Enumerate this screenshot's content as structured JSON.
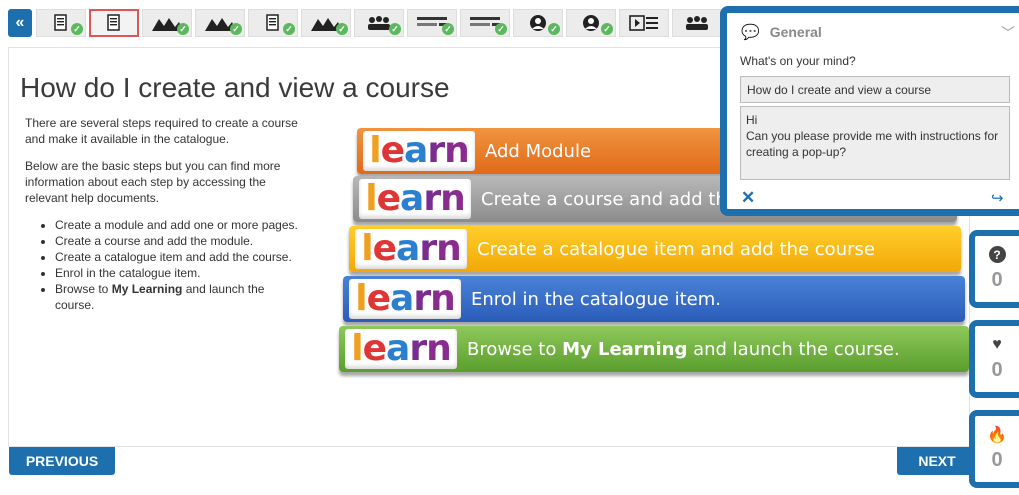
{
  "nav": {
    "back_label": "«"
  },
  "thumbnails": [
    {
      "icon": "document-icon",
      "completed": true,
      "active": false
    },
    {
      "icon": "document-icon",
      "completed": false,
      "active": true
    },
    {
      "icon": "people-icon",
      "completed": true,
      "active": false
    },
    {
      "icon": "people-icon",
      "completed": true,
      "active": false
    },
    {
      "icon": "document-icon",
      "completed": true,
      "active": false
    },
    {
      "icon": "people-icon",
      "completed": true,
      "active": false
    },
    {
      "icon": "group-icon",
      "completed": true,
      "active": false
    },
    {
      "icon": "form-icon",
      "completed": true,
      "active": false
    },
    {
      "icon": "form-icon",
      "completed": true,
      "active": false
    },
    {
      "icon": "person-circle-icon",
      "completed": true,
      "active": false
    },
    {
      "icon": "person-circle-icon",
      "completed": true,
      "active": false
    },
    {
      "icon": "video-list-icon",
      "completed": false,
      "active": false
    },
    {
      "icon": "group-icon",
      "completed": false,
      "active": false
    }
  ],
  "content": {
    "title": "How do I create and view a course",
    "intro1": "There are several steps required to create a course and make it available in the catalogue.",
    "intro2": "Below are the basic steps but you can find more information about each step by accessing the relevant help documents.",
    "steps": [
      "Create a module and add one or more pages.",
      "Create a course and add the module.",
      "Create a catalogue item and add the course.",
      "Enrol in the catalogue item.",
      "Browse to My Learning and launch the course."
    ],
    "step5_prefix": "Browse to ",
    "step5_bold": "My Learning",
    "step5_suffix": " and launch the course."
  },
  "banners": {
    "logo_text": "learn",
    "b1": "Add Module",
    "b2": "Create a course and add th",
    "b3": "Create a catalogue item and add the course",
    "b4": "Enrol in the catalogue item.",
    "b5_prefix": "Browse to ",
    "b5_bold": "My Learning",
    "b5_suffix": " and launch the course."
  },
  "footer": {
    "previous_label": "PREVIOUS",
    "next_label": "NEXT"
  },
  "popup": {
    "category": "General",
    "prompt": "What's on your mind?",
    "subject": "How do I create and view a course",
    "message": "Hi\nCan you please provide me with instructions for creating a pop-up?",
    "close_icon": "close-icon",
    "share_icon": "share-icon"
  },
  "counters": [
    {
      "icon": "question-icon",
      "value": "0"
    },
    {
      "icon": "heart-icon",
      "value": "0"
    },
    {
      "icon": "flame-icon",
      "value": "0"
    }
  ],
  "colors": {
    "primary": "#1d6fad",
    "check": "#5cb85c",
    "active_border": "#e05555"
  }
}
